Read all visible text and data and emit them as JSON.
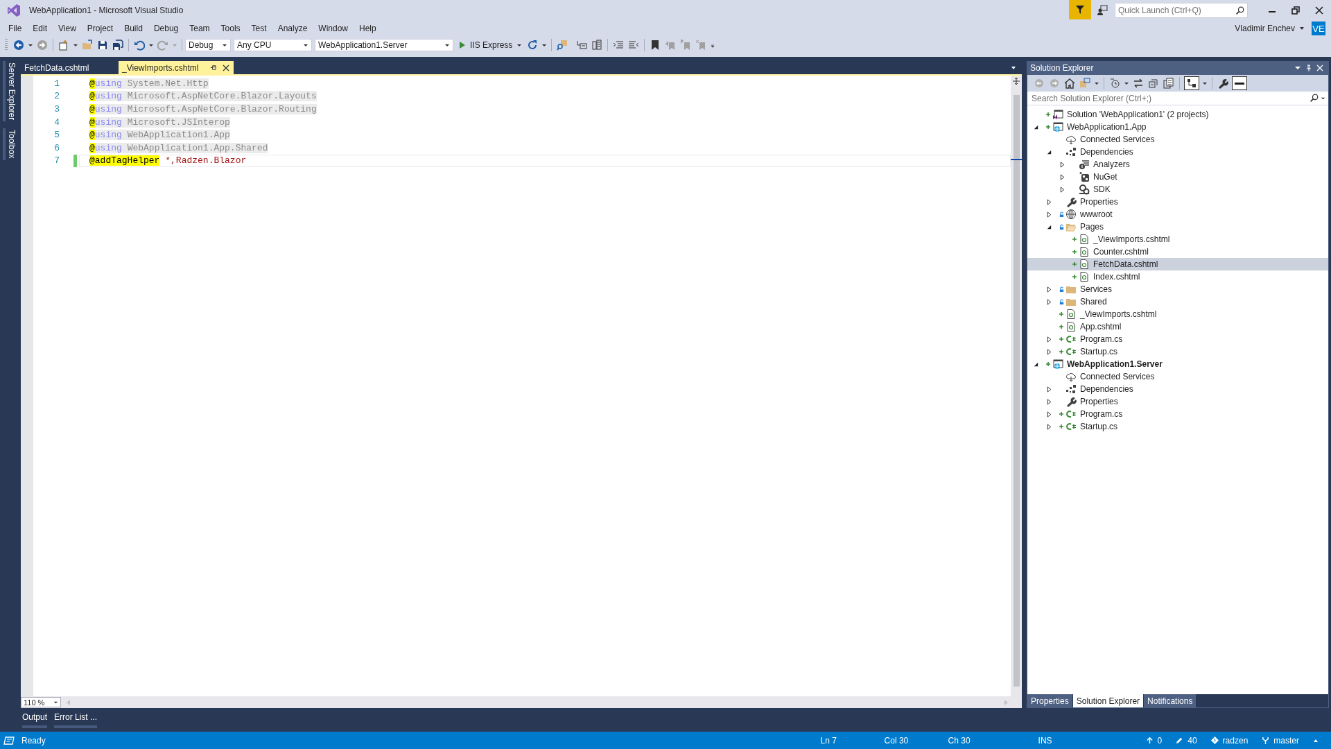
{
  "window": {
    "title": "WebApplication1 - Microsoft Visual Studio"
  },
  "menu": [
    "File",
    "Edit",
    "View",
    "Project",
    "Build",
    "Debug",
    "Team",
    "Tools",
    "Test",
    "Analyze",
    "Window",
    "Help"
  ],
  "toolbar": {
    "configuration": "Debug",
    "platform": "Any CPU",
    "startup_project": "WebApplication1.Server",
    "run_target": "IIS Express"
  },
  "quick_launch": {
    "placeholder": "Quick Launch (Ctrl+Q)"
  },
  "user": {
    "name": "Vladimir Enchev",
    "initials": "VE"
  },
  "side_tabs": [
    "Server Explorer",
    "Toolbox"
  ],
  "editor": {
    "tabs": [
      {
        "label": "FetchData.cshtml",
        "selected": false
      },
      {
        "label": "_ViewImports.cshtml",
        "selected": true
      }
    ],
    "lines": [
      {
        "number": "1",
        "kind": "using",
        "directive": "@",
        "keyword": "using",
        "text": "System.Net.Http",
        "changed": false,
        "current": false
      },
      {
        "number": "2",
        "kind": "using",
        "directive": "@",
        "keyword": "using",
        "text": "Microsoft.AspNetCore.Blazor.Layouts",
        "changed": false,
        "current": false
      },
      {
        "number": "3",
        "kind": "using",
        "directive": "@",
        "keyword": "using",
        "text": "Microsoft.AspNetCore.Blazor.Routing",
        "changed": false,
        "current": false
      },
      {
        "number": "4",
        "kind": "using",
        "directive": "@",
        "keyword": "using",
        "text": "Microsoft.JSInterop",
        "changed": false,
        "current": false
      },
      {
        "number": "5",
        "kind": "using",
        "directive": "@",
        "keyword": "using",
        "text": "WebApplication1.App",
        "changed": false,
        "current": false
      },
      {
        "number": "6",
        "kind": "using",
        "directive": "@",
        "keyword": "using",
        "text": "WebApplication1.App.Shared",
        "changed": false,
        "current": false
      },
      {
        "number": "7",
        "kind": "tag_helper",
        "directive": "@addTagHelper",
        "text": "*,Radzen.Blazor",
        "changed": true,
        "current": true
      }
    ],
    "zoom": "110 %"
  },
  "solution_explorer": {
    "title": "Solution Explorer",
    "search_placeholder": "Search Solution Explorer (Ctrl+;)",
    "tree": [
      {
        "label": "Solution 'WebApplication1' (2 projects)",
        "kind": "solution",
        "expandable": false,
        "added": true,
        "locked": false,
        "selected": false,
        "bold": false
      },
      {
        "label": "WebApplication1.App",
        "kind": "web_project",
        "expandable": true,
        "expanded": true,
        "added": true,
        "locked": false,
        "selected": false,
        "bold": false,
        "children": [
          {
            "label": "Connected Services",
            "kind": "cloud",
            "expandable": false,
            "added": false,
            "locked": false,
            "selected": false,
            "bold": false
          },
          {
            "label": "Dependencies",
            "kind": "dependencies",
            "expandable": true,
            "expanded": true,
            "added": false,
            "locked": false,
            "selected": false,
            "bold": false,
            "children": [
              {
                "label": "Analyzers",
                "kind": "analyzers",
                "expandable": true,
                "expanded": false,
                "added": false,
                "locked": false,
                "selected": false,
                "bold": false
              },
              {
                "label": "NuGet",
                "kind": "nuget",
                "expandable": true,
                "expanded": false,
                "added": false,
                "locked": false,
                "selected": false,
                "bold": false
              },
              {
                "label": "SDK",
                "kind": "sdk",
                "expandable": true,
                "expanded": false,
                "added": false,
                "locked": false,
                "selected": false,
                "bold": false
              }
            ]
          },
          {
            "label": "Properties",
            "kind": "properties",
            "expandable": true,
            "expanded": false,
            "added": false,
            "locked": false,
            "selected": false,
            "bold": false
          },
          {
            "label": "wwwroot",
            "kind": "web_root",
            "expandable": true,
            "expanded": false,
            "added": false,
            "locked": true,
            "selected": false,
            "bold": false
          },
          {
            "label": "Pages",
            "kind": "folder",
            "expandable": true,
            "expanded": true,
            "added": false,
            "locked": true,
            "selected": false,
            "bold": false,
            "children": [
              {
                "label": "_ViewImports.cshtml",
                "kind": "razor",
                "expandable": false,
                "added": true,
                "locked": false,
                "selected": false,
                "bold": false
              },
              {
                "label": "Counter.cshtml",
                "kind": "razor",
                "expandable": false,
                "added": true,
                "locked": false,
                "selected": false,
                "bold": false
              },
              {
                "label": "FetchData.cshtml",
                "kind": "razor",
                "expandable": false,
                "added": true,
                "locked": false,
                "selected": true,
                "bold": false
              },
              {
                "label": "Index.cshtml",
                "kind": "razor",
                "expandable": false,
                "added": true,
                "locked": false,
                "selected": false,
                "bold": false
              }
            ]
          },
          {
            "label": "Services",
            "kind": "folder",
            "expandable": true,
            "expanded": false,
            "added": false,
            "locked": true,
            "selected": false,
            "bold": false
          },
          {
            "label": "Shared",
            "kind": "folder",
            "expandable": true,
            "expanded": false,
            "added": false,
            "locked": true,
            "selected": false,
            "bold": false
          },
          {
            "label": "_ViewImports.cshtml",
            "kind": "razor",
            "expandable": false,
            "added": true,
            "locked": false,
            "selected": false,
            "bold": false
          },
          {
            "label": "App.cshtml",
            "kind": "razor",
            "expandable": false,
            "added": true,
            "locked": false,
            "selected": false,
            "bold": false
          },
          {
            "label": "Program.cs",
            "kind": "csharp",
            "expandable": true,
            "expanded": false,
            "added": true,
            "locked": false,
            "selected": false,
            "bold": false
          },
          {
            "label": "Startup.cs",
            "kind": "csharp",
            "expandable": true,
            "expanded": false,
            "added": true,
            "locked": false,
            "selected": false,
            "bold": false
          }
        ]
      },
      {
        "label": "WebApplication1.Server",
        "kind": "web_project",
        "expandable": true,
        "expanded": true,
        "added": true,
        "locked": false,
        "selected": false,
        "bold": true,
        "children": [
          {
            "label": "Connected Services",
            "kind": "cloud",
            "expandable": false,
            "added": false,
            "locked": false,
            "selected": false,
            "bold": false
          },
          {
            "label": "Dependencies",
            "kind": "dependencies",
            "expandable": true,
            "expanded": false,
            "added": false,
            "locked": false,
            "selected": false,
            "bold": false
          },
          {
            "label": "Properties",
            "kind": "properties",
            "expandable": true,
            "expanded": false,
            "added": false,
            "locked": false,
            "selected": false,
            "bold": false
          },
          {
            "label": "Program.cs",
            "kind": "csharp",
            "expandable": true,
            "expanded": false,
            "added": true,
            "locked": false,
            "selected": false,
            "bold": false
          },
          {
            "label": "Startup.cs",
            "kind": "csharp",
            "expandable": true,
            "expanded": false,
            "added": true,
            "locked": false,
            "selected": false,
            "bold": false
          }
        ]
      }
    ],
    "bottom_tabs": [
      {
        "label": "Properties",
        "selected": false
      },
      {
        "label": "Solution Explorer",
        "selected": true
      },
      {
        "label": "Notifications",
        "selected": false
      }
    ]
  },
  "output_tabs": [
    "Output",
    "Error List ..."
  ],
  "status_bar": {
    "message": "Ready",
    "line": "Ln 7",
    "column": "Col 30",
    "char": "Ch 30",
    "mode": "INS",
    "pushes": "0",
    "changes": "40",
    "repository": "radzen",
    "branch": "master"
  }
}
